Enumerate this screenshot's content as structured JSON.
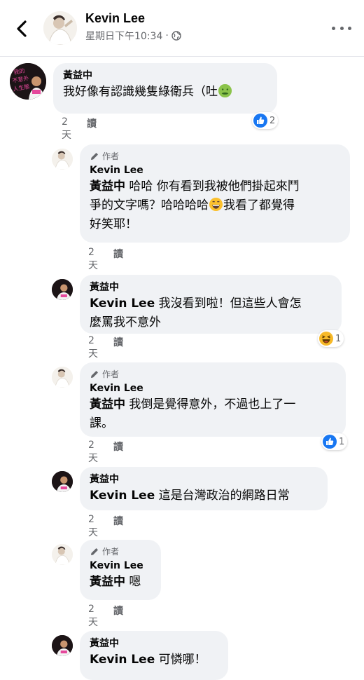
{
  "header": {
    "name": "Kevin Lee",
    "time": "星期日下午10:34",
    "separator": "·"
  },
  "comments": [
    {
      "name": "黃益中",
      "avatar_text": "我的\n不意外\n人生態",
      "text": "我好像有認識幾隻綠衛兵（吐",
      "emoji_icon": "nauseated-face",
      "age": "2天",
      "read": "讀",
      "reaction": {
        "icon": "like",
        "count": "2"
      }
    },
    {
      "badge": "作者",
      "name": "Kevin Lee",
      "mention": "黃益中",
      "text_a": " 哈哈 你有看到我被他們掛起來鬥",
      "text_b": "爭的文字嗎？哈哈哈哈",
      "text_c": "我看了都覺得",
      "text_d": "好笑耶！",
      "emoji_icon": "grinning-face",
      "age": "2天",
      "read": "讀"
    },
    {
      "name": "黃益中",
      "mention": "Kevin Lee",
      "text_a": " 我沒看到啦！但這些人會怎",
      "text_b": "麼罵我不意外",
      "age": "2天",
      "read": "讀",
      "reaction": {
        "icon": "haha",
        "count": "1"
      }
    },
    {
      "badge": "作者",
      "name": "Kevin Lee",
      "mention": "黃益中",
      "text_a": " 我倒是覺得意外，不過也上了一",
      "text_b": "課。",
      "age": "2天",
      "read": "讀",
      "reaction": {
        "icon": "like",
        "count": "1"
      }
    },
    {
      "name": "黃益中",
      "mention": "Kevin Lee",
      "text_a": " 這是台灣政治的網路日常",
      "age": "2天",
      "read": "讀"
    },
    {
      "badge": "作者",
      "name": "Kevin Lee",
      "mention": "黃益中",
      "text_a": " 嗯",
      "age": "2天",
      "read": "讀"
    },
    {
      "name": "黃益中",
      "mention": "Kevin Lee",
      "text_a": " 可憐哪！"
    }
  ],
  "colors": {
    "bubble": "#f0f2f5",
    "like": "#1877f2",
    "haha": "#f7b928",
    "avatar_dark": "#1c1416",
    "avatar_pink": "#e5479b"
  }
}
